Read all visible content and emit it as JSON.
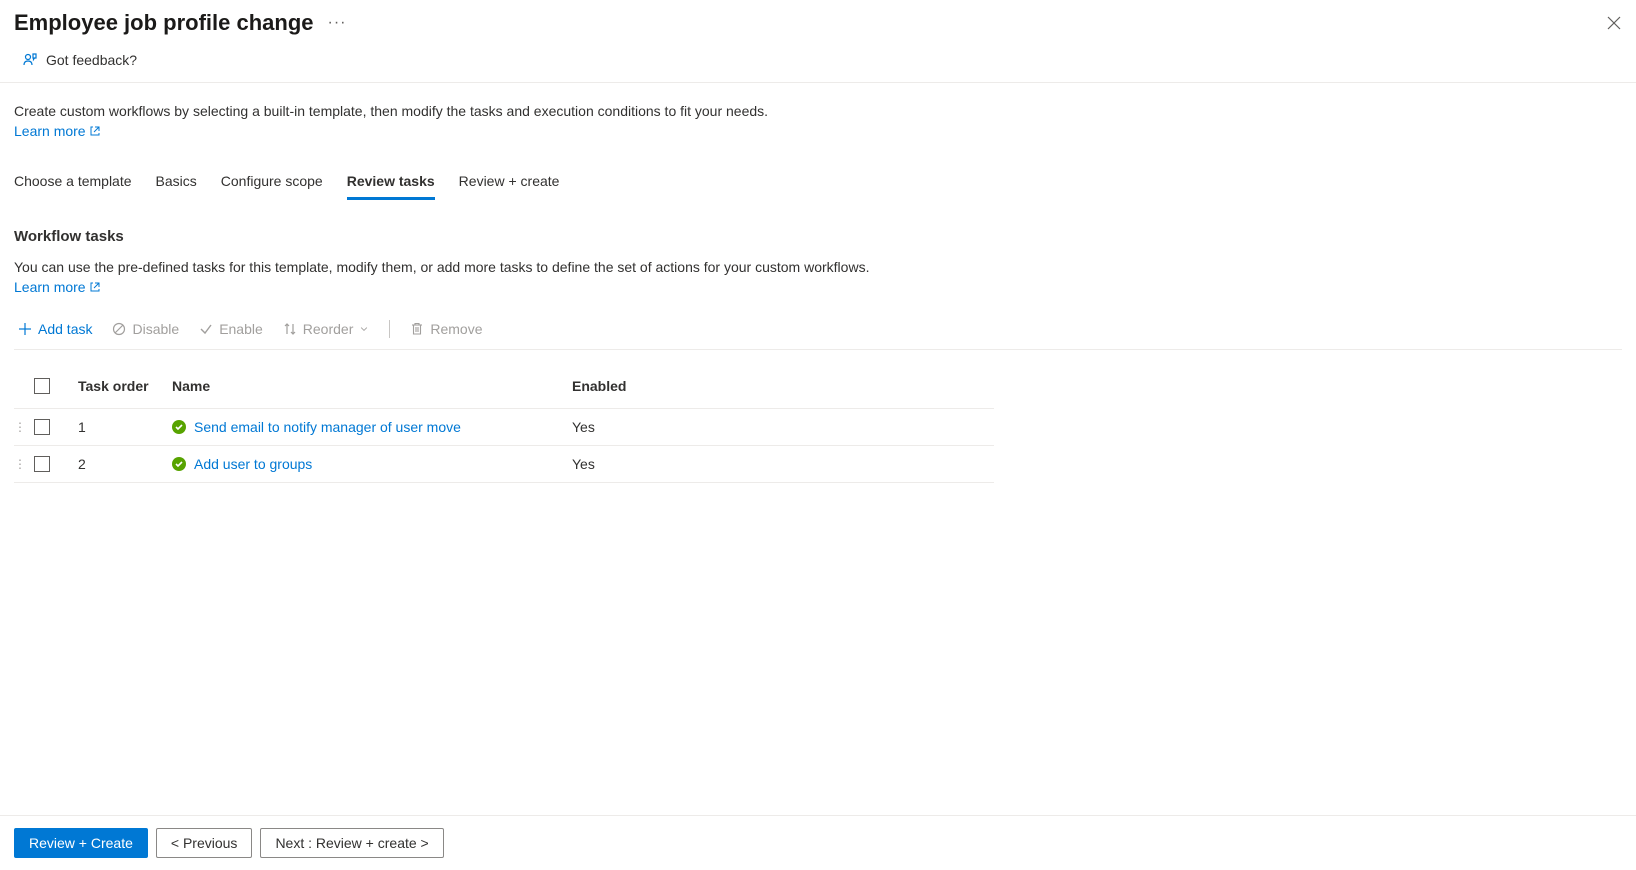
{
  "header": {
    "title": "Employee job profile change"
  },
  "feedback": {
    "label": "Got feedback?"
  },
  "intro": {
    "description": "Create custom workflows by selecting a built-in template, then modify the tasks and execution conditions to fit your needs.",
    "learn_more": "Learn more"
  },
  "tabs": [
    {
      "label": "Choose a template",
      "active": false
    },
    {
      "label": "Basics",
      "active": false
    },
    {
      "label": "Configure scope",
      "active": false
    },
    {
      "label": "Review tasks",
      "active": true
    },
    {
      "label": "Review + create",
      "active": false
    }
  ],
  "section": {
    "title": "Workflow tasks",
    "description": "You can use the pre-defined tasks for this template, modify them, or add more tasks to define the set of actions for your custom workflows.",
    "learn_more": "Learn more"
  },
  "toolbar": {
    "add": "Add task",
    "disable": "Disable",
    "enable": "Enable",
    "reorder": "Reorder",
    "remove": "Remove"
  },
  "table": {
    "headers": {
      "order": "Task order",
      "name": "Name",
      "enabled": "Enabled"
    },
    "rows": [
      {
        "order": "1",
        "name": "Send email to notify manager of user move",
        "enabled": "Yes"
      },
      {
        "order": "2",
        "name": "Add user to groups",
        "enabled": "Yes"
      }
    ]
  },
  "footer": {
    "review": "Review + Create",
    "previous": "< Previous",
    "next": "Next : Review + create >"
  }
}
